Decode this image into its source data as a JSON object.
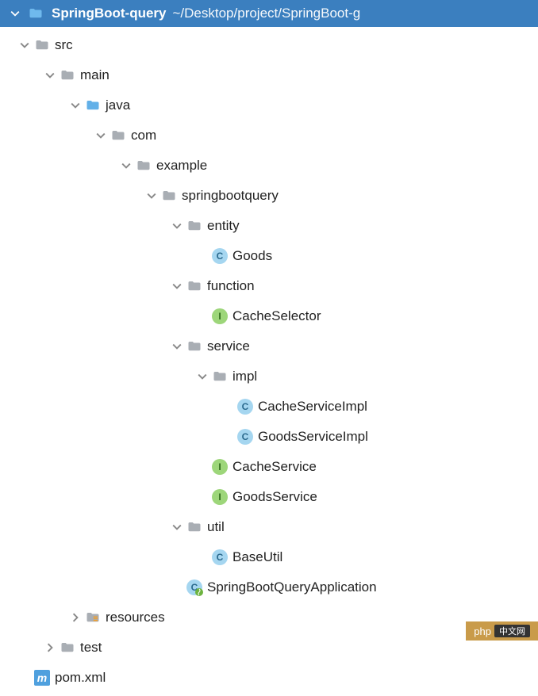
{
  "header": {
    "project_name": "SpringBoot-query",
    "project_path": "~/Desktop/project/SpringBoot-g"
  },
  "tree": [
    {
      "level": 0,
      "expand": "down",
      "icon": "folder-gray",
      "label": "src"
    },
    {
      "level": 1,
      "expand": "down",
      "icon": "folder-gray",
      "label": "main"
    },
    {
      "level": 2,
      "expand": "down",
      "icon": "folder-blue",
      "label": "java"
    },
    {
      "level": 3,
      "expand": "down",
      "icon": "folder-gray",
      "label": "com"
    },
    {
      "level": 4,
      "expand": "down",
      "icon": "folder-gray",
      "label": "example"
    },
    {
      "level": 5,
      "expand": "down",
      "icon": "folder-gray",
      "label": "springbootquery"
    },
    {
      "level": 6,
      "expand": "down",
      "icon": "folder-gray",
      "label": "entity"
    },
    {
      "level": 7,
      "expand": "none",
      "icon": "class",
      "label": "Goods"
    },
    {
      "level": 6,
      "expand": "down",
      "icon": "folder-gray",
      "label": "function"
    },
    {
      "level": 7,
      "expand": "none",
      "icon": "interface",
      "label": "CacheSelector"
    },
    {
      "level": 6,
      "expand": "down",
      "icon": "folder-gray",
      "label": "service"
    },
    {
      "level": 7,
      "expand": "down",
      "icon": "folder-gray",
      "label": "impl"
    },
    {
      "level": 8,
      "expand": "none",
      "icon": "class",
      "label": "CacheServiceImpl"
    },
    {
      "level": 8,
      "expand": "none",
      "icon": "class",
      "label": "GoodsServiceImpl"
    },
    {
      "level": 7,
      "expand": "none",
      "icon": "interface",
      "label": "CacheService"
    },
    {
      "level": 7,
      "expand": "none",
      "icon": "interface",
      "label": "GoodsService"
    },
    {
      "level": 6,
      "expand": "down",
      "icon": "folder-gray",
      "label": "util"
    },
    {
      "level": 7,
      "expand": "none",
      "icon": "class",
      "label": "BaseUtil"
    },
    {
      "level": 6,
      "expand": "none",
      "icon": "spring",
      "label": "SpringBootQueryApplication"
    },
    {
      "level": 2,
      "expand": "right",
      "icon": "folder-resources",
      "label": "resources"
    },
    {
      "level": 1,
      "expand": "right",
      "icon": "folder-gray",
      "label": "test"
    },
    {
      "level": 0,
      "expand": "none",
      "icon": "maven",
      "label": "pom.xml"
    }
  ],
  "watermark": {
    "text1": "php",
    "text2": "中文网"
  }
}
